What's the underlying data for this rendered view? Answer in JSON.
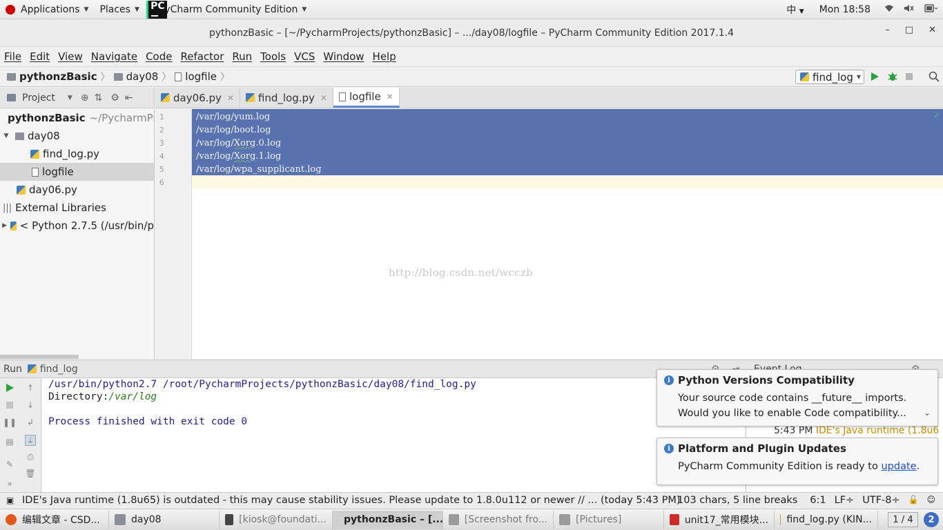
{
  "gnome": {
    "applications": "Applications",
    "places": "Places",
    "active_app": "PyCharm Community Edition",
    "input_method": "中",
    "clock": "Mon 18:58"
  },
  "window": {
    "title": "pythonzBasic – [~/PycharmProjects/pythonzBasic] – .../day08/logfile – PyCharm Community Edition 2017.1.4",
    "minimize": "–",
    "maximize": "□",
    "close": "✕"
  },
  "menu": [
    "File",
    "Edit",
    "View",
    "Navigate",
    "Code",
    "Refactor",
    "Run",
    "Tools",
    "VCS",
    "Window",
    "Help"
  ],
  "breadcrumb": [
    "pythonzBasic",
    "day08",
    "logfile"
  ],
  "run_config": "find_log",
  "project_panel": {
    "label": "Project",
    "tree": [
      {
        "label": "pythonzBasic",
        "suffix": "~/PycharmPro"
      },
      {
        "label": "day08"
      },
      {
        "label": "find_log.py"
      },
      {
        "label": "logfile"
      },
      {
        "label": "day06.py"
      },
      {
        "label": "External Libraries"
      },
      {
        "label": "< Python 2.7.5 (/usr/bin/p"
      }
    ]
  },
  "tabs": [
    {
      "label": "day06.py"
    },
    {
      "label": "find_log.py"
    },
    {
      "label": "logfile"
    }
  ],
  "editor": {
    "line_numbers": [
      "1",
      "2",
      "3",
      "4",
      "5",
      "6"
    ],
    "lines": [
      {
        "pre": "/var/log/yum.log",
        "sq": "",
        "post": ""
      },
      {
        "pre": "/var/log/boot.log",
        "sq": "",
        "post": ""
      },
      {
        "pre": "/var/log/",
        "sq": "Xorg",
        "post": ".0.log"
      },
      {
        "pre": "/var/log/",
        "sq": "Xorg",
        "post": ".1.log"
      },
      {
        "pre": "/var/log/wpa_supplicant.log",
        "sq": "",
        "post": ""
      },
      {
        "pre": "",
        "sq": "",
        "post": ""
      }
    ],
    "watermark": "http://blog.csdn.net/wcczb"
  },
  "run_panel": {
    "label": "Run",
    "config": "find_log",
    "console": {
      "cmd": "/usr/bin/python2.7 /root/PycharmProjects/pythonzBasic/day08/find_log.py",
      "out_label": "Directory:",
      "out_value": "/var/log",
      "exit": "Process finished with exit code 0"
    }
  },
  "event_log": {
    "title": "Event Log",
    "time": "5:43 PM",
    "text": "IDE's Java runtime (1.8u6"
  },
  "notifications": [
    {
      "title": "Python Versions Compatibility",
      "line1": "Your source code contains __future__ imports.",
      "line2": "Would you like to enable Code compatibility..."
    },
    {
      "title": "Platform and Plugin Updates",
      "text": "PyCharm Community Edition is ready to ",
      "link": "update",
      "after": "."
    }
  ],
  "status": {
    "message": "IDE's Java runtime (1.8u65) is outdated - this may cause stability issues. Please update to 1.8.0u112 or newer // ... (today 5:43 PM)",
    "chars": "103 chars, 5 line breaks",
    "position": "6:1",
    "line_sep": "LF÷",
    "encoding": "UTF-8÷"
  },
  "taskbar": [
    {
      "label": "编辑文章 - CSD...",
      "color": "#e0581c"
    },
    {
      "label": "day08",
      "color": "#8a8f99"
    },
    {
      "label": "[kiosk@foundati...",
      "color": "#444444"
    },
    {
      "label": "pythonzBasic – [...",
      "color": "#111111"
    },
    {
      "label": "[Screenshot fro...",
      "color": "#9a9a9a"
    },
    {
      "label": "[Pictures]",
      "color": "#9a9a9a"
    },
    {
      "label": "unit17_常用模块...",
      "color": "#cc2b2b"
    },
    {
      "label": "find_log.py (KIN...",
      "color": "#c9a13a"
    }
  ],
  "workspace": {
    "indicator": "1 / 4",
    "badge": "2"
  }
}
